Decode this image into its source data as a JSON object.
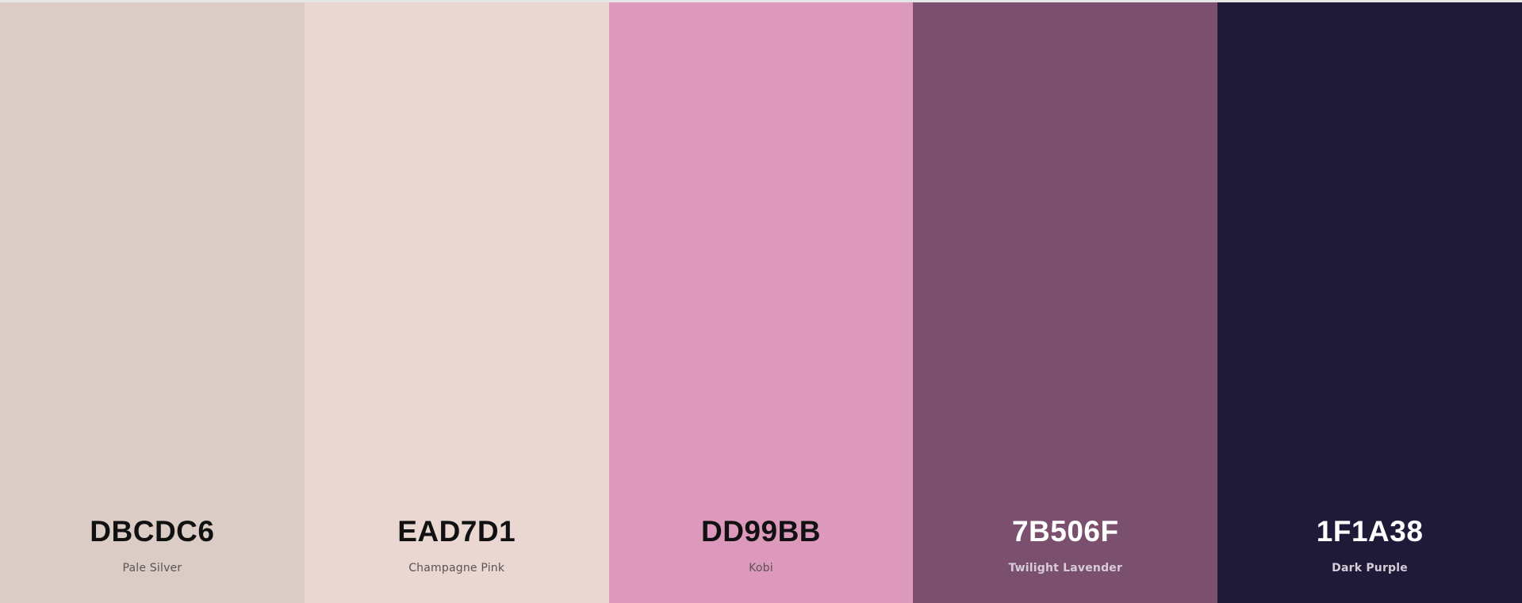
{
  "palette": {
    "colors": [
      {
        "hex_label": "DBCDC6",
        "name": "Pale Silver",
        "color": "#DBCDC6",
        "tone": "light"
      },
      {
        "hex_label": "EAD7D1",
        "name": "Champagne Pink",
        "color": "#EAD7D1",
        "tone": "light"
      },
      {
        "hex_label": "DD99BB",
        "name": "Kobi",
        "color": "#DD99BB",
        "tone": "light"
      },
      {
        "hex_label": "7B506F",
        "name": "Twilight Lavender",
        "color": "#7B506F",
        "tone": "dark"
      },
      {
        "hex_label": "1F1A38",
        "name": "Dark Purple",
        "color": "#1F1A38",
        "tone": "dark"
      }
    ]
  }
}
